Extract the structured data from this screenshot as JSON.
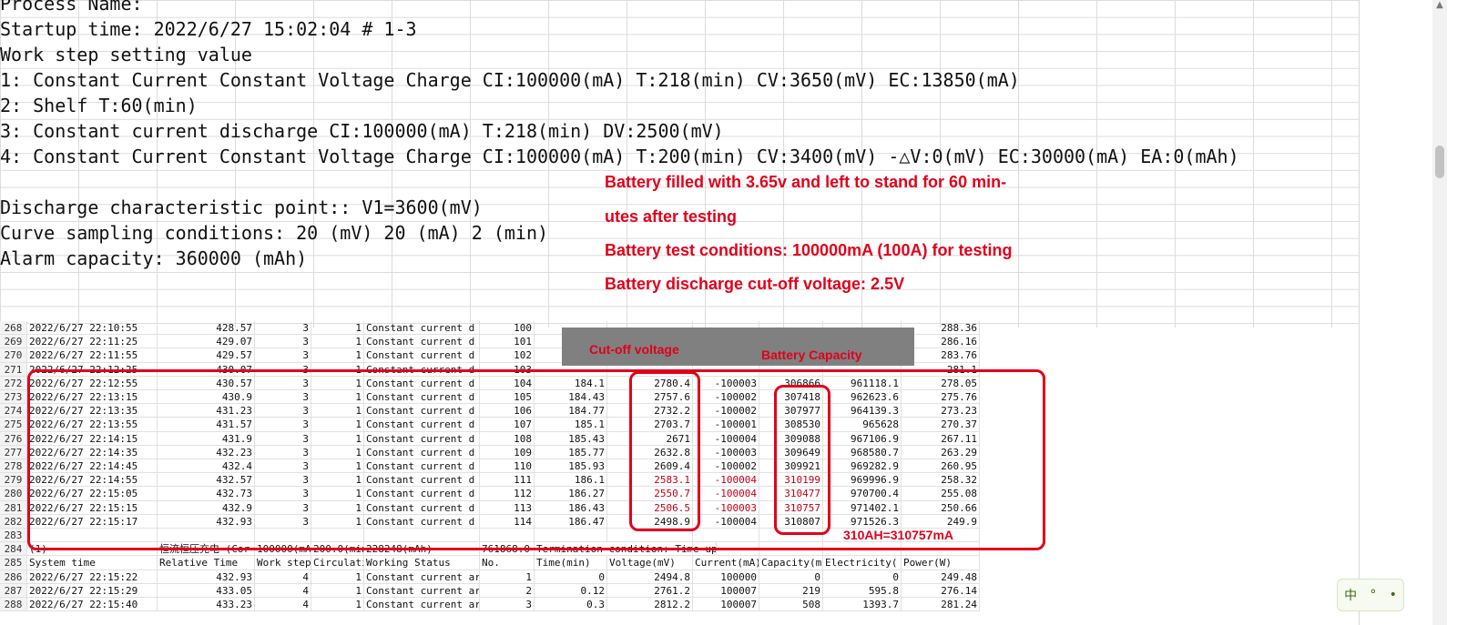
{
  "notes": {
    "lines": [
      "Process Name:",
      "Startup time: 2022/6/27 15:02:04 # 1-3",
      "Work step setting value",
      "1: Constant Current Constant Voltage Charge CI:100000(mA) T:218(min) CV:3650(mV) EC:13850(mA)",
      "2: Shelf T:60(min)",
      "3: Constant current discharge CI:100000(mA) T:218(min) DV:2500(mV)",
      "4: Constant Current Constant Voltage Charge CI:100000(mA) T:200(min) CV:3400(mV) -△V:0(mV) EC:30000(mA) EA:0(mAh)",
      "",
      "Discharge characteristic point:: V1=3600(mV)",
      "Curve sampling conditions: 20 (mV) 20 (mA) 2 (min)",
      "Alarm capacity: 360000 (mAh)"
    ]
  },
  "annotations": {
    "line1": "Battery filled with 3.65v and left to stand for 60 min-",
    "line2": "utes after testing",
    "line3": "Battery test conditions: 100000mA (100A) for testing",
    "line4": "Battery discharge cut-off voltage: 2.5V",
    "cutoff_label": "Cut-off voltage",
    "capacity_label": "Battery Capacity",
    "result_label": "310AH=310757mA"
  },
  "sheet": {
    "rows": [
      {
        "n": "268",
        "t": "2022/6/27 22:10:55",
        "rel": "428.57",
        "ws": "3",
        "c": "1",
        "st": "Constant current d",
        "no": "100",
        "tm": "",
        "v": "",
        "i": "",
        "cap": "",
        "e": "",
        "p": "288.36"
      },
      {
        "n": "269",
        "t": "2022/6/27 22:11:25",
        "rel": "429.07",
        "ws": "3",
        "c": "1",
        "st": "Constant current d",
        "no": "101",
        "tm": "",
        "v": "",
        "i": "",
        "cap": "",
        "e": "",
        "p": "286.16"
      },
      {
        "n": "270",
        "t": "2022/6/27 22:11:55",
        "rel": "429.57",
        "ws": "3",
        "c": "1",
        "st": "Constant current d",
        "no": "102",
        "tm": "",
        "v": "",
        "i": "",
        "cap": "",
        "e": "",
        "p": "283.76"
      },
      {
        "n": "271",
        "t": "2022/6/27 22:12:25",
        "rel": "430.07",
        "ws": "3",
        "c": "1",
        "st": "Constant current d",
        "no": "103",
        "tm": "",
        "v": "",
        "i": "",
        "cap": "",
        "e": "",
        "p": "281.1"
      },
      {
        "n": "272",
        "t": "2022/6/27 22:12:55",
        "rel": "430.57",
        "ws": "3",
        "c": "1",
        "st": "Constant current d",
        "no": "104",
        "tm": "184.1",
        "v": "2780.4",
        "i": "-100003",
        "cap": "306866",
        "e": "961118.1",
        "p": "278.05"
      },
      {
        "n": "273",
        "t": "2022/6/27 22:13:15",
        "rel": "430.9",
        "ws": "3",
        "c": "1",
        "st": "Constant current d",
        "no": "105",
        "tm": "184.43",
        "v": "2757.6",
        "i": "-100002",
        "cap": "307418",
        "e": "962623.6",
        "p": "275.76"
      },
      {
        "n": "274",
        "t": "2022/6/27 22:13:35",
        "rel": "431.23",
        "ws": "3",
        "c": "1",
        "st": "Constant current d",
        "no": "106",
        "tm": "184.77",
        "v": "2732.2",
        "i": "-100002",
        "cap": "307977",
        "e": "964139.3",
        "p": "273.23"
      },
      {
        "n": "275",
        "t": "2022/6/27 22:13:55",
        "rel": "431.57",
        "ws": "3",
        "c": "1",
        "st": "Constant current d",
        "no": "107",
        "tm": "185.1",
        "v": "2703.7",
        "i": "-100001",
        "cap": "308530",
        "e": "965628",
        "p": "270.37"
      },
      {
        "n": "276",
        "t": "2022/6/27 22:14:15",
        "rel": "431.9",
        "ws": "3",
        "c": "1",
        "st": "Constant current d",
        "no": "108",
        "tm": "185.43",
        "v": "2671",
        "i": "-100004",
        "cap": "309088",
        "e": "967106.9",
        "p": "267.11"
      },
      {
        "n": "277",
        "t": "2022/6/27 22:14:35",
        "rel": "432.23",
        "ws": "3",
        "c": "1",
        "st": "Constant current d",
        "no": "109",
        "tm": "185.77",
        "v": "2632.8",
        "i": "-100003",
        "cap": "309649",
        "e": "968580.7",
        "p": "263.29"
      },
      {
        "n": "278",
        "t": "2022/6/27 22:14:45",
        "rel": "432.4",
        "ws": "3",
        "c": "1",
        "st": "Constant current d",
        "no": "110",
        "tm": "185.93",
        "v": "2609.4",
        "i": "-100002",
        "cap": "309921",
        "e": "969282.9",
        "p": "260.95"
      },
      {
        "n": "279",
        "t": "2022/6/27 22:14:55",
        "rel": "432.57",
        "ws": "3",
        "c": "1",
        "st": "Constant current d",
        "no": "111",
        "tm": "186.1",
        "v": "2583.1",
        "i": "-100004",
        "cap": "310199",
        "e": "969996.9",
        "p": "258.32",
        "red": true
      },
      {
        "n": "280",
        "t": "2022/6/27 22:15:05",
        "rel": "432.73",
        "ws": "3",
        "c": "1",
        "st": "Constant current d",
        "no": "112",
        "tm": "186.27",
        "v": "2550.7",
        "i": "-100004",
        "cap": "310477",
        "e": "970700.4",
        "p": "255.08",
        "red": true
      },
      {
        "n": "281",
        "t": "2022/6/27 22:15:15",
        "rel": "432.9",
        "ws": "3",
        "c": "1",
        "st": "Constant current d",
        "no": "113",
        "tm": "186.43",
        "v": "2506.5",
        "i": "-100003",
        "cap": "310757",
        "e": "971402.1",
        "p": "250.66",
        "red": true
      },
      {
        "n": "282",
        "t": "2022/6/27 22:15:17",
        "rel": "432.93",
        "ws": "3",
        "c": "1",
        "st": "Constant current d",
        "no": "114",
        "tm": "186.47",
        "v": "2498.9",
        "i": "-100004",
        "cap": "310807",
        "e": "971526.3",
        "p": "249.9"
      },
      {
        "n": "283",
        "t": "",
        "rel": "",
        "ws": "",
        "c": "",
        "st": "",
        "no": "",
        "tm": "",
        "v": "",
        "i": "",
        "cap": "",
        "e": "",
        "p": ""
      },
      {
        "n": "284",
        "t": "(1)",
        "rel": "恒流恒压充电 (Cor",
        "ws": "100000(mA",
        "c": "200.0(min",
        "st": "228248(mAh)",
        "no": "761868.0",
        "tm": "Termination condition: Time up",
        "v": "",
        "i": "",
        "cap": "",
        "e": "",
        "p": ""
      },
      {
        "n": "285",
        "t": "System time",
        "rel": "Relative Time",
        "ws": "Work step",
        "c": "Circulati",
        "st": "Working Status",
        "no": "No.",
        "tm": "Time(min)",
        "v": "Voltage(mV)",
        "i": "Current(mA)",
        "cap": "Capacity(m",
        "e": "Electricity(",
        "p": "Power(W)"
      },
      {
        "n": "286",
        "t": "2022/6/27 22:15:22",
        "rel": "432.93",
        "ws": "4",
        "c": "1",
        "st": "Constant current ar",
        "no": "1",
        "tm": "0",
        "v": "2494.8",
        "i": "100000",
        "cap": "0",
        "e": "0",
        "p": "249.48"
      },
      {
        "n": "287",
        "t": "2022/6/27 22:15:29",
        "rel": "433.05",
        "ws": "4",
        "c": "1",
        "st": "Constant current ar",
        "no": "2",
        "tm": "0.12",
        "v": "2761.2",
        "i": "100007",
        "cap": "219",
        "e": "595.8",
        "p": "276.14"
      },
      {
        "n": "288",
        "t": "2022/6/27 22:15:40",
        "rel": "433.23",
        "ws": "4",
        "c": "1",
        "st": "Constant current ar",
        "no": "3",
        "tm": "0.3",
        "v": "2812.2",
        "i": "100007",
        "cap": "508",
        "e": "1393.7",
        "p": "281.24"
      }
    ]
  },
  "ime": {
    "label1": "中",
    "label2": "°",
    "label3": "•"
  }
}
